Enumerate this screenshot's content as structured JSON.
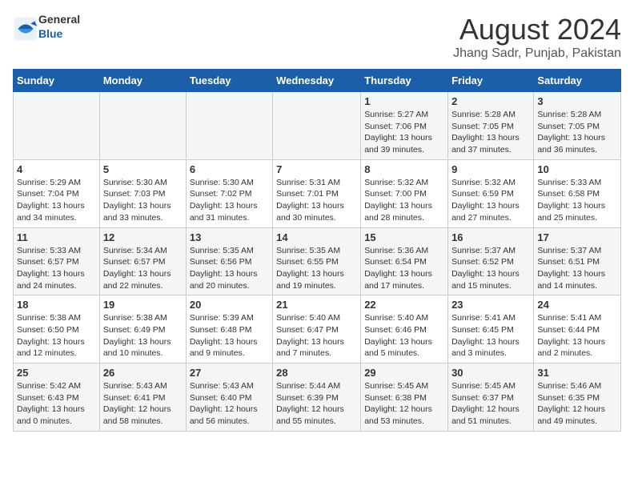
{
  "header": {
    "logo_general": "General",
    "logo_blue": "Blue",
    "month": "August 2024",
    "location": "Jhang Sadr, Punjab, Pakistan"
  },
  "weekdays": [
    "Sunday",
    "Monday",
    "Tuesday",
    "Wednesday",
    "Thursday",
    "Friday",
    "Saturday"
  ],
  "weeks": [
    [
      {
        "day": "",
        "info": ""
      },
      {
        "day": "",
        "info": ""
      },
      {
        "day": "",
        "info": ""
      },
      {
        "day": "",
        "info": ""
      },
      {
        "day": "1",
        "info": "Sunrise: 5:27 AM\nSunset: 7:06 PM\nDaylight: 13 hours\nand 39 minutes."
      },
      {
        "day": "2",
        "info": "Sunrise: 5:28 AM\nSunset: 7:05 PM\nDaylight: 13 hours\nand 37 minutes."
      },
      {
        "day": "3",
        "info": "Sunrise: 5:28 AM\nSunset: 7:05 PM\nDaylight: 13 hours\nand 36 minutes."
      }
    ],
    [
      {
        "day": "4",
        "info": "Sunrise: 5:29 AM\nSunset: 7:04 PM\nDaylight: 13 hours\nand 34 minutes."
      },
      {
        "day": "5",
        "info": "Sunrise: 5:30 AM\nSunset: 7:03 PM\nDaylight: 13 hours\nand 33 minutes."
      },
      {
        "day": "6",
        "info": "Sunrise: 5:30 AM\nSunset: 7:02 PM\nDaylight: 13 hours\nand 31 minutes."
      },
      {
        "day": "7",
        "info": "Sunrise: 5:31 AM\nSunset: 7:01 PM\nDaylight: 13 hours\nand 30 minutes."
      },
      {
        "day": "8",
        "info": "Sunrise: 5:32 AM\nSunset: 7:00 PM\nDaylight: 13 hours\nand 28 minutes."
      },
      {
        "day": "9",
        "info": "Sunrise: 5:32 AM\nSunset: 6:59 PM\nDaylight: 13 hours\nand 27 minutes."
      },
      {
        "day": "10",
        "info": "Sunrise: 5:33 AM\nSunset: 6:58 PM\nDaylight: 13 hours\nand 25 minutes."
      }
    ],
    [
      {
        "day": "11",
        "info": "Sunrise: 5:33 AM\nSunset: 6:57 PM\nDaylight: 13 hours\nand 24 minutes."
      },
      {
        "day": "12",
        "info": "Sunrise: 5:34 AM\nSunset: 6:57 PM\nDaylight: 13 hours\nand 22 minutes."
      },
      {
        "day": "13",
        "info": "Sunrise: 5:35 AM\nSunset: 6:56 PM\nDaylight: 13 hours\nand 20 minutes."
      },
      {
        "day": "14",
        "info": "Sunrise: 5:35 AM\nSunset: 6:55 PM\nDaylight: 13 hours\nand 19 minutes."
      },
      {
        "day": "15",
        "info": "Sunrise: 5:36 AM\nSunset: 6:54 PM\nDaylight: 13 hours\nand 17 minutes."
      },
      {
        "day": "16",
        "info": "Sunrise: 5:37 AM\nSunset: 6:52 PM\nDaylight: 13 hours\nand 15 minutes."
      },
      {
        "day": "17",
        "info": "Sunrise: 5:37 AM\nSunset: 6:51 PM\nDaylight: 13 hours\nand 14 minutes."
      }
    ],
    [
      {
        "day": "18",
        "info": "Sunrise: 5:38 AM\nSunset: 6:50 PM\nDaylight: 13 hours\nand 12 minutes."
      },
      {
        "day": "19",
        "info": "Sunrise: 5:38 AM\nSunset: 6:49 PM\nDaylight: 13 hours\nand 10 minutes."
      },
      {
        "day": "20",
        "info": "Sunrise: 5:39 AM\nSunset: 6:48 PM\nDaylight: 13 hours\nand 9 minutes."
      },
      {
        "day": "21",
        "info": "Sunrise: 5:40 AM\nSunset: 6:47 PM\nDaylight: 13 hours\nand 7 minutes."
      },
      {
        "day": "22",
        "info": "Sunrise: 5:40 AM\nSunset: 6:46 PM\nDaylight: 13 hours\nand 5 minutes."
      },
      {
        "day": "23",
        "info": "Sunrise: 5:41 AM\nSunset: 6:45 PM\nDaylight: 13 hours\nand 3 minutes."
      },
      {
        "day": "24",
        "info": "Sunrise: 5:41 AM\nSunset: 6:44 PM\nDaylight: 13 hours\nand 2 minutes."
      }
    ],
    [
      {
        "day": "25",
        "info": "Sunrise: 5:42 AM\nSunset: 6:43 PM\nDaylight: 13 hours\nand 0 minutes."
      },
      {
        "day": "26",
        "info": "Sunrise: 5:43 AM\nSunset: 6:41 PM\nDaylight: 12 hours\nand 58 minutes."
      },
      {
        "day": "27",
        "info": "Sunrise: 5:43 AM\nSunset: 6:40 PM\nDaylight: 12 hours\nand 56 minutes."
      },
      {
        "day": "28",
        "info": "Sunrise: 5:44 AM\nSunset: 6:39 PM\nDaylight: 12 hours\nand 55 minutes."
      },
      {
        "day": "29",
        "info": "Sunrise: 5:45 AM\nSunset: 6:38 PM\nDaylight: 12 hours\nand 53 minutes."
      },
      {
        "day": "30",
        "info": "Sunrise: 5:45 AM\nSunset: 6:37 PM\nDaylight: 12 hours\nand 51 minutes."
      },
      {
        "day": "31",
        "info": "Sunrise: 5:46 AM\nSunset: 6:35 PM\nDaylight: 12 hours\nand 49 minutes."
      }
    ]
  ]
}
